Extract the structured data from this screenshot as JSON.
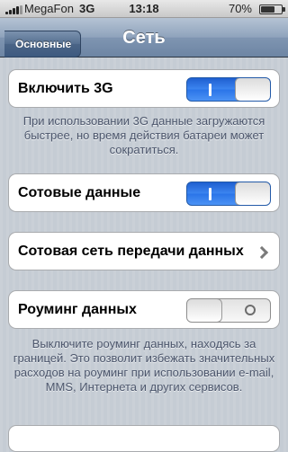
{
  "status_bar": {
    "carrier": "MegaFon",
    "network": "3G",
    "time": "13:18",
    "battery_percent": "70%",
    "battery_level": 0.7
  },
  "nav": {
    "back_label": "Основные",
    "title": "Сеть"
  },
  "settings": {
    "enable_3g": {
      "label": "Включить 3G",
      "state": "on"
    },
    "enable_3g_footer": "При использовании 3G данные загружаются быстрее, но время действия батареи может сократиться.",
    "cellular_data": {
      "label": "Сотовые данные",
      "state": "on"
    },
    "cellular_network": {
      "label": "Сотовая сеть передачи данных"
    },
    "data_roaming": {
      "label": "Роуминг данных",
      "state": "off"
    },
    "roaming_footer": "Выключите роуминг данных, находясь за границей. Это позволит избежать значительных расходов на роуминг при использовании e-mail, MMS, Интернета и других сервисов."
  },
  "icons": {
    "signal": "signal-bars-icon",
    "battery": "battery-icon",
    "back": "back-arrow-icon",
    "switch_on": "switch-on-glyph",
    "switch_off": "switch-off-glyph",
    "disclosure": "chevron-right-icon"
  },
  "colors": {
    "switch_on": "#2a74e8",
    "nav_bar": "#6d85a4",
    "background": "#c5ccd4",
    "footer_text": "#4c566c"
  }
}
